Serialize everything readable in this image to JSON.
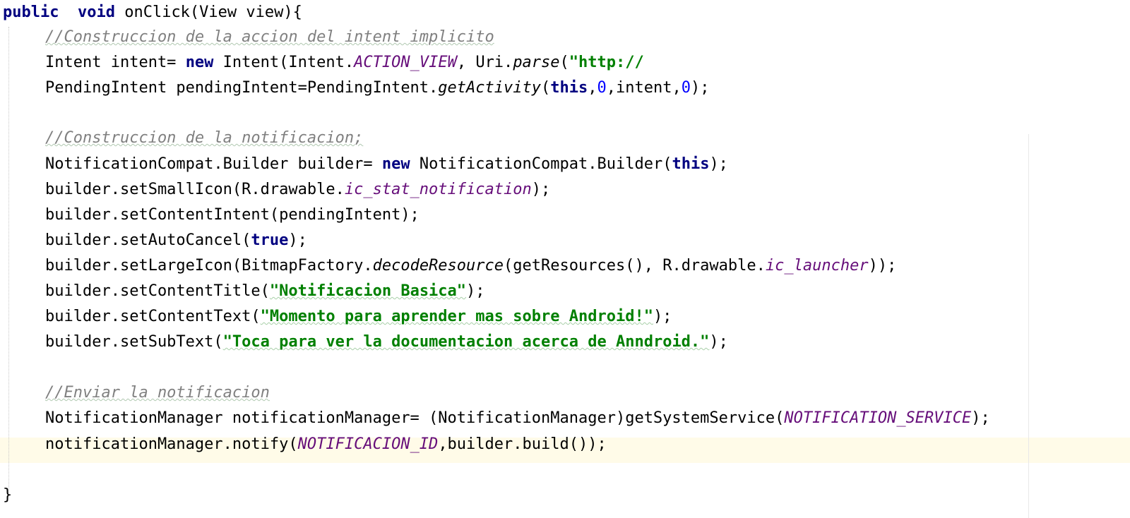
{
  "code": {
    "l1": {
      "public": "public",
      "void": "void",
      "rest": " onClick(View view){"
    },
    "l2": "//Construccion de la accion del intent implicito",
    "l3": {
      "a": "Intent intent= ",
      "new": "new",
      "b": " Intent(Intent.",
      "action_view": "ACTION_VIEW",
      "c": ", Uri.",
      "parse": "parse",
      "d": "(",
      "str": "\"http://"
    },
    "l4": {
      "a": "PendingIntent pendingIntent=PendingIntent.",
      "getActivity": "getActivity",
      "b": "(",
      "this": "this",
      "c": ",",
      "zero1": "0",
      "d": ",intent,",
      "zero2": "0",
      "e": ");"
    },
    "l6": "//Construccion de la notificacion;",
    "l7": {
      "a": "NotificationCompat.Builder builder= ",
      "new": "new",
      "b": " NotificationCompat.Builder(",
      "this": "this",
      "c": ");"
    },
    "l8": {
      "a": "builder.setSmallIcon(R.drawable.",
      "field": "ic_stat_notification",
      "b": ");"
    },
    "l9": "builder.setContentIntent(pendingIntent);",
    "l10": {
      "a": "builder.setAutoCancel(",
      "true": "true",
      "b": ");"
    },
    "l11": {
      "a": "builder.setLargeIcon(BitmapFactory.",
      "decode": "decodeResource",
      "b": "(getResources(), R.drawable.",
      "field": "ic_launcher",
      "c": "));"
    },
    "l12": {
      "a": "builder.setContentTitle(",
      "str": "\"Notificacion Basica\"",
      "b": ");"
    },
    "l13": {
      "a": "builder.setContentText(",
      "str": "\"Momento para aprender mas sobre Android!\"",
      "b": ");"
    },
    "l14": {
      "a": "builder.setSubText(",
      "str": "\"Toca para ver la documentacion acerca de Anndroid.\"",
      "b": ");"
    },
    "l16": "//Enviar la notificacion",
    "l17": {
      "a": "NotificationManager notificationManager= (NotificationManager)getSystemService(",
      "field": "NOTIFICATION_SERVICE",
      "b": ");"
    },
    "l18": {
      "a": "notificationManager.notify(",
      "field": "NOTIFICACION_ID",
      "b": ",builder.build());"
    },
    "l20": "}"
  },
  "colors": {
    "keyword": "#000080",
    "comment": "#808080",
    "string": "#008000",
    "field": "#660e7a",
    "number": "#0000ff",
    "current_line": "#fffbe8"
  }
}
